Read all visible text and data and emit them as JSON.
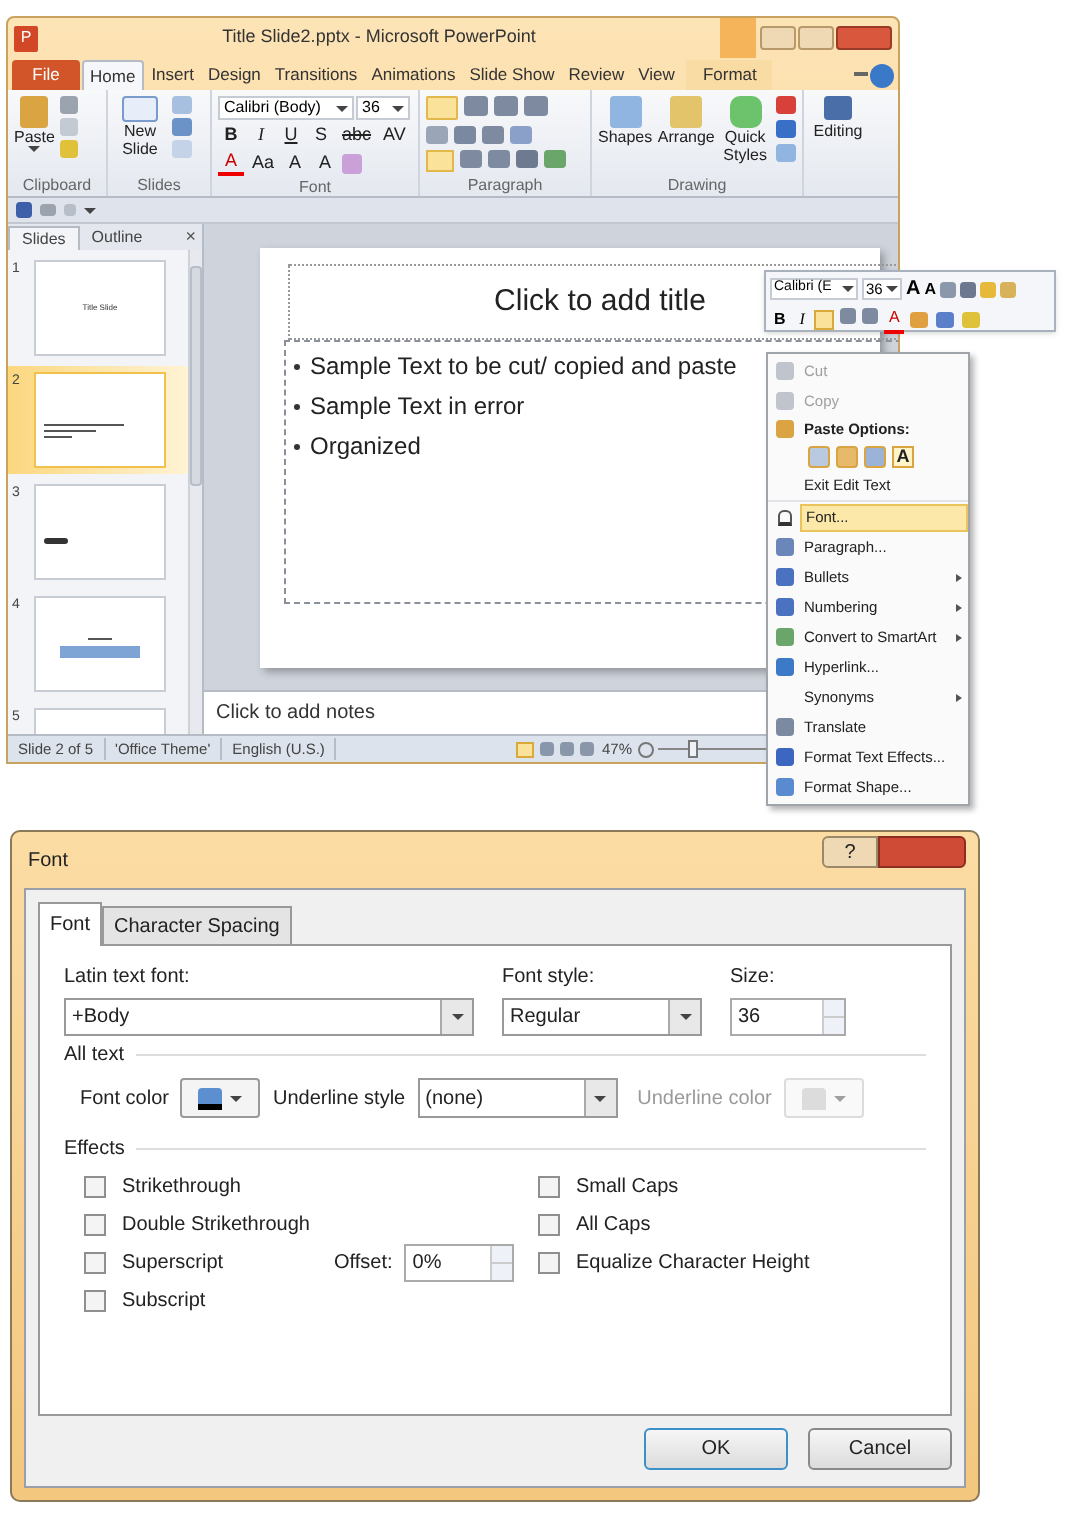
{
  "window": {
    "title": "Title Slide2.pptx - Microsoft PowerPoint",
    "app_letter": "P"
  },
  "ribbon_tabs": [
    {
      "label": "File",
      "kind": "file",
      "selected": false
    },
    {
      "label": "Home",
      "kind": "tab",
      "selected": true
    },
    {
      "label": "Insert",
      "kind": "tab",
      "selected": false
    },
    {
      "label": "Design",
      "kind": "tab",
      "selected": false
    },
    {
      "label": "Transitions",
      "kind": "tab",
      "selected": false
    },
    {
      "label": "Animations",
      "kind": "tab",
      "selected": false
    },
    {
      "label": "Slide Show",
      "kind": "tab",
      "selected": false
    },
    {
      "label": "Review",
      "kind": "tab",
      "selected": false
    },
    {
      "label": "View",
      "kind": "tab",
      "selected": false
    },
    {
      "label": "Format",
      "kind": "contextual",
      "selected": false
    }
  ],
  "ribbon": {
    "groups": [
      "Clipboard",
      "Slides",
      "Font",
      "Paragraph",
      "Drawing"
    ],
    "paste": "Paste",
    "new_slide": "New Slide",
    "font_name": "Calibri (Body)",
    "font_size": "36",
    "format_row": [
      "B",
      "I",
      "U",
      "S",
      "abc",
      "AV"
    ],
    "font_row": [
      "A",
      "Aa",
      "A",
      "A"
    ],
    "shapes": "Shapes",
    "arrange": "Arrange",
    "quick_styles": "Quick Styles",
    "editing": "Editing"
  },
  "pane_tabs": [
    {
      "label": "Slides",
      "selected": true
    },
    {
      "label": "Outline",
      "selected": false
    }
  ],
  "pane_close": "×",
  "slides": [
    {
      "number": "1",
      "title": "Title Slide",
      "selected": false,
      "kind": "title"
    },
    {
      "number": "2",
      "selected": true,
      "kind": "bullets"
    },
    {
      "number": "3",
      "selected": false,
      "kind": "dots"
    },
    {
      "number": "4",
      "selected": false,
      "kind": "table"
    },
    {
      "number": "5",
      "selected": false,
      "kind": "title_top"
    }
  ],
  "slide": {
    "title": "Click to add title",
    "bullets": [
      "Sample Text to be cut/ copied and paste",
      "Sample Text in error",
      "Organized"
    ]
  },
  "notes": "Click to add notes",
  "status_bar": {
    "items": [
      "Slide 2 of 5",
      "'Office Theme'",
      "English (U.S.)"
    ],
    "zoom": "47%",
    "zoom_slider": {
      "level": 0.25
    }
  },
  "mini_toolbar": {
    "font_name": "Calibri (E",
    "font_size": "36",
    "row1": [
      "A",
      "A"
    ],
    "row2": [
      "B",
      "I",
      "A"
    ]
  },
  "context_menu": {
    "items": [
      {
        "kind": "item",
        "label": "Cut",
        "disabled": true,
        "selected": false,
        "submenu": false
      },
      {
        "kind": "item",
        "label": "Copy",
        "disabled": true,
        "selected": false,
        "submenu": false
      },
      {
        "kind": "header",
        "label": "Paste Options:"
      },
      {
        "kind": "paste_icons",
        "letter": "A"
      },
      {
        "kind": "plain",
        "label": "Exit Edit Text"
      },
      {
        "kind": "item",
        "label": "Font...",
        "disabled": false,
        "selected": true,
        "submenu": false
      },
      {
        "kind": "item",
        "label": "Paragraph...",
        "disabled": false,
        "selected": false,
        "submenu": false
      },
      {
        "kind": "item",
        "label": "Bullets",
        "disabled": false,
        "selected": false,
        "submenu": true
      },
      {
        "kind": "item",
        "label": "Numbering",
        "disabled": false,
        "selected": false,
        "submenu": true
      },
      {
        "kind": "item",
        "label": "Convert to SmartArt",
        "disabled": false,
        "selected": false,
        "submenu": true
      },
      {
        "kind": "item",
        "label": "Hyperlink...",
        "disabled": false,
        "selected": false,
        "submenu": false
      },
      {
        "kind": "item",
        "label": "Synonyms",
        "disabled": false,
        "selected": false,
        "submenu": true
      },
      {
        "kind": "item",
        "label": "Translate",
        "disabled": false,
        "selected": false,
        "submenu": false
      },
      {
        "kind": "item",
        "label": "Format Text Effects...",
        "disabled": false,
        "selected": false,
        "submenu": false
      },
      {
        "kind": "item",
        "label": "Format Shape...",
        "disabled": false,
        "selected": false,
        "submenu": false
      }
    ]
  },
  "dialog": {
    "title": "Font",
    "help": "?",
    "tabs": [
      {
        "label": "Font",
        "selected": true
      },
      {
        "label": "Character Spacing",
        "selected": false
      }
    ],
    "latin_font": {
      "label": "Latin text font:",
      "value": "+Body"
    },
    "font_style": {
      "label": "Font style:",
      "value": "Regular"
    },
    "size": {
      "label": "Size:",
      "value": "36"
    },
    "all_text": "All text",
    "font_color": "Font color",
    "underline_style": {
      "label": "Underline style",
      "value": "(none)"
    },
    "underline_color": {
      "label": "Underline color",
      "disabled": true
    },
    "effects": "Effects",
    "left_checks": [
      {
        "label": "Strikethrough",
        "checked": false
      },
      {
        "label": "Double Strikethrough",
        "checked": false
      },
      {
        "label": "Superscript",
        "checked": false
      },
      {
        "label": "Subscript",
        "checked": false
      }
    ],
    "offset": {
      "label": "Offset:",
      "value": "0%"
    },
    "right_checks": [
      {
        "label": "Small Caps",
        "checked": false
      },
      {
        "label": "All Caps",
        "checked": false
      },
      {
        "label": "Equalize Character Height",
        "checked": false
      }
    ],
    "buttons": [
      "OK",
      "Cancel"
    ]
  }
}
